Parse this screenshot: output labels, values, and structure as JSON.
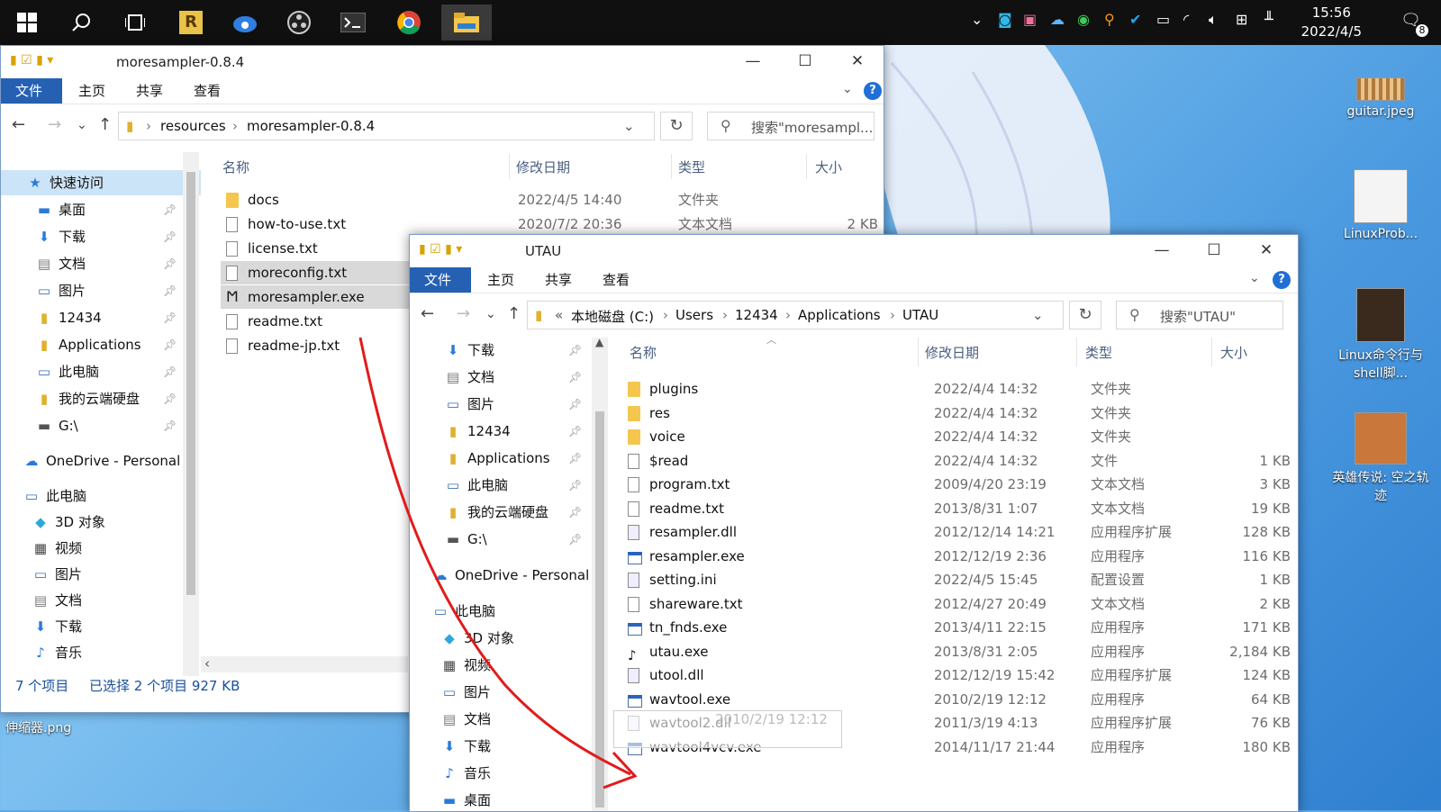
{
  "taskbar": {
    "icons": [
      "windows-start-icon",
      "search-icon",
      "task-view-icon",
      "r-app-icon",
      "cloud-app-icon",
      "obs-icon",
      "terminal-icon",
      "chrome-icon",
      "file-explorer-icon"
    ],
    "clock_time": "15:56",
    "clock_date": "2022/4/5",
    "notification_count": "8"
  },
  "desktop": {
    "items": [
      {
        "label": "guitar.jpeg"
      },
      {
        "label": "LinuxProb..."
      },
      {
        "label": "Linux命令行与shell脚..."
      },
      {
        "label": "英雄传说: 空之轨迹"
      },
      {
        "label": "伸缩器.png"
      }
    ]
  },
  "win1": {
    "title": "moresampler-0.8.4",
    "controls": {
      "minimize": "—",
      "maximize": "☐",
      "close": "✕"
    },
    "ribbon": {
      "file": "文件",
      "home": "主页",
      "share": "共享",
      "view": "查看"
    },
    "breadcrumbs": [
      "resources",
      "moresampler-0.8.4"
    ],
    "search_placeholder": "搜索\"moresampl...",
    "nav": [
      {
        "label": "快速访问",
        "icon": "star-icon"
      },
      {
        "label": "桌面",
        "icon": "desktop-icon"
      },
      {
        "label": "下载",
        "icon": "download-icon"
      },
      {
        "label": "文档",
        "icon": "document-icon"
      },
      {
        "label": "图片",
        "icon": "picture-icon"
      },
      {
        "label": "12434",
        "icon": "folder-icon"
      },
      {
        "label": "Applications",
        "icon": "folder-icon"
      },
      {
        "label": "此电脑",
        "icon": "computer-icon"
      },
      {
        "label": "我的云端硬盘",
        "icon": "folder-icon"
      },
      {
        "label": "G:\\",
        "icon": "drive-icon"
      },
      {
        "label": "OneDrive - Personal",
        "icon": "onedrive-icon"
      },
      {
        "label": "此电脑",
        "icon": "computer-icon"
      },
      {
        "label": "3D 对象",
        "icon": "cube-icon"
      },
      {
        "label": "视频",
        "icon": "video-icon"
      },
      {
        "label": "图片",
        "icon": "picture-icon"
      },
      {
        "label": "文档",
        "icon": "document-icon"
      },
      {
        "label": "下载",
        "icon": "download-icon"
      },
      {
        "label": "音乐",
        "icon": "music-icon"
      }
    ],
    "columns": {
      "name": "名称",
      "date": "修改日期",
      "type": "类型",
      "size": "大小"
    },
    "files": [
      {
        "name": "docs",
        "date": "2022/4/5 14:40",
        "type": "文件夹",
        "size": "",
        "icon": "folder-icon"
      },
      {
        "name": "how-to-use.txt",
        "date": "2020/7/2 20:36",
        "type": "文本文档",
        "size": "2 KB",
        "icon": "text-file-icon"
      },
      {
        "name": "license.txt",
        "date": "",
        "type": "",
        "size": "",
        "icon": "text-file-icon"
      },
      {
        "name": "moreconfig.txt",
        "date": "",
        "type": "",
        "size": "",
        "icon": "text-file-icon"
      },
      {
        "name": "moresampler.exe",
        "date": "",
        "type": "",
        "size": "",
        "icon": "exe-icon"
      },
      {
        "name": "readme.txt",
        "date": "",
        "type": "",
        "size": "",
        "icon": "text-file-icon"
      },
      {
        "name": "readme-jp.txt",
        "date": "",
        "type": "",
        "size": "",
        "icon": "text-file-icon"
      }
    ],
    "status": {
      "count": "7 个项目",
      "selected": "已选择 2 个项目  927 KB"
    }
  },
  "win2": {
    "title": "UTAU",
    "controls": {
      "minimize": "—",
      "maximize": "☐",
      "close": "✕"
    },
    "ribbon": {
      "file": "文件",
      "home": "主页",
      "share": "共享",
      "view": "查看"
    },
    "breadcrumbs": [
      "«",
      "本地磁盘 (C:)",
      "Users",
      "12434",
      "Applications",
      "UTAU"
    ],
    "search_placeholder": "搜索\"UTAU\"",
    "nav": [
      {
        "label": "下载",
        "icon": "download-icon"
      },
      {
        "label": "文档",
        "icon": "document-icon"
      },
      {
        "label": "图片",
        "icon": "picture-icon"
      },
      {
        "label": "12434",
        "icon": "folder-icon"
      },
      {
        "label": "Applications",
        "icon": "folder-icon"
      },
      {
        "label": "此电脑",
        "icon": "computer-icon"
      },
      {
        "label": "我的云端硬盘",
        "icon": "folder-icon"
      },
      {
        "label": "G:\\",
        "icon": "drive-icon"
      },
      {
        "label": "OneDrive - Personal",
        "icon": "onedrive-icon"
      },
      {
        "label": "此电脑",
        "icon": "computer-icon"
      },
      {
        "label": "3D 对象",
        "icon": "cube-icon"
      },
      {
        "label": "视频",
        "icon": "video-icon"
      },
      {
        "label": "图片",
        "icon": "picture-icon"
      },
      {
        "label": "文档",
        "icon": "document-icon"
      },
      {
        "label": "下载",
        "icon": "download-icon"
      },
      {
        "label": "音乐",
        "icon": "music-icon"
      },
      {
        "label": "桌面",
        "icon": "desktop-icon"
      }
    ],
    "columns": {
      "name": "名称",
      "date": "修改日期",
      "type": "类型",
      "size": "大小"
    },
    "files": [
      {
        "name": "plugins",
        "date": "2022/4/4 14:32",
        "type": "文件夹",
        "size": "",
        "icon": "folder-icon"
      },
      {
        "name": "res",
        "date": "2022/4/4 14:32",
        "type": "文件夹",
        "size": "",
        "icon": "folder-icon"
      },
      {
        "name": "voice",
        "date": "2022/4/4 14:32",
        "type": "文件夹",
        "size": "",
        "icon": "folder-icon"
      },
      {
        "name": "$read",
        "date": "2022/4/4 14:32",
        "type": "文件",
        "size": "1 KB",
        "icon": "file-icon"
      },
      {
        "name": "program.txt",
        "date": "2009/4/20 23:19",
        "type": "文本文档",
        "size": "3 KB",
        "icon": "text-file-icon"
      },
      {
        "name": "readme.txt",
        "date": "2013/8/31 1:07",
        "type": "文本文档",
        "size": "19 KB",
        "icon": "text-file-icon"
      },
      {
        "name": "resampler.dll",
        "date": "2012/12/14 14:21",
        "type": "应用程序扩展",
        "size": "128 KB",
        "icon": "dll-icon"
      },
      {
        "name": "resampler.exe",
        "date": "2012/12/19 2:36",
        "type": "应用程序",
        "size": "116 KB",
        "icon": "exe-icon"
      },
      {
        "name": "setting.ini",
        "date": "2022/4/5 15:45",
        "type": "配置设置",
        "size": "1 KB",
        "icon": "settings-file-icon"
      },
      {
        "name": "shareware.txt",
        "date": "2012/4/27 20:49",
        "type": "文本文档",
        "size": "2 KB",
        "icon": "text-file-icon"
      },
      {
        "name": "tn_fnds.exe",
        "date": "2013/4/11 22:15",
        "type": "应用程序",
        "size": "171 KB",
        "icon": "exe-icon"
      },
      {
        "name": "utau.exe",
        "date": "2013/8/31 2:05",
        "type": "应用程序",
        "size": "2,184 KB",
        "icon": "utau-exe-icon"
      },
      {
        "name": "utool.dll",
        "date": "2012/12/19 15:42",
        "type": "应用程序扩展",
        "size": "124 KB",
        "icon": "dll-icon"
      },
      {
        "name": "wavtool.exe",
        "date": "2010/2/19 12:12",
        "type": "应用程序",
        "size": "64 KB",
        "icon": "exe-icon"
      },
      {
        "name": "wavtool2.dll",
        "date": "2011/3/19 4:13",
        "type": "应用程序扩展",
        "size": "76 KB",
        "icon": "dll-icon"
      },
      {
        "name": "wavtool4vcv.exe",
        "date": "2014/11/17 21:44",
        "type": "应用程序",
        "size": "180 KB",
        "icon": "exe-icon"
      }
    ],
    "drag_ghost_text": "2010/2/19 12:12"
  },
  "colors": {
    "accent": "#2560b3",
    "selection": "#cce4f7",
    "annotation": "#e11b1b",
    "folder": "#f4c64e"
  }
}
